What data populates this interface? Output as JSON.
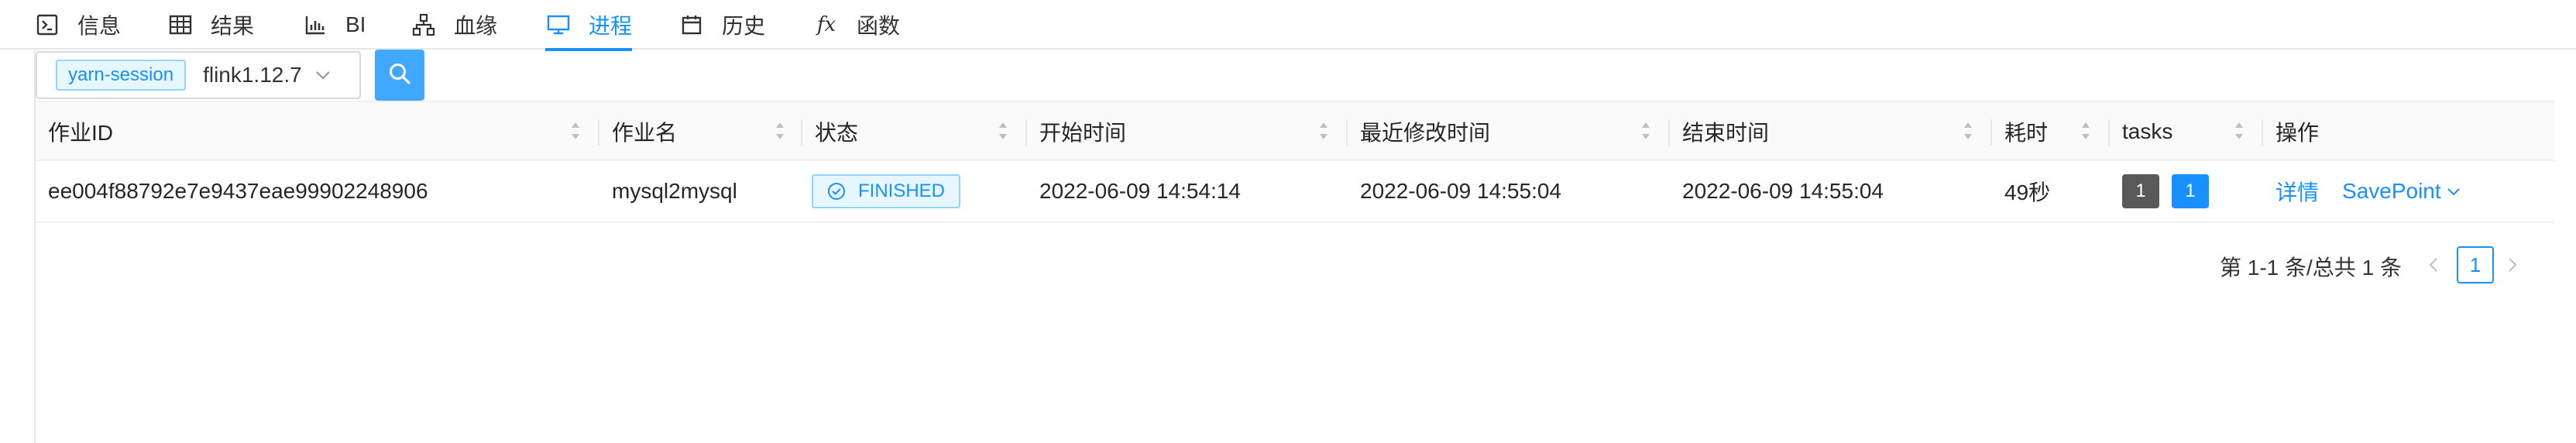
{
  "tabs": [
    {
      "label": "信息",
      "icon": "terminal-icon"
    },
    {
      "label": "结果",
      "icon": "table-icon"
    },
    {
      "label": "BI",
      "icon": "bar-chart-icon"
    },
    {
      "label": "血缘",
      "icon": "lineage-icon"
    },
    {
      "label": "进程",
      "icon": "desktop-icon",
      "active": true
    },
    {
      "label": "历史",
      "icon": "calendar-icon"
    },
    {
      "label": "函数",
      "icon": "function-icon",
      "icon_text": "fx"
    }
  ],
  "search": {
    "tag": "yarn-session",
    "selected_cluster": "flink1.12.7"
  },
  "table": {
    "columns": [
      "作业ID",
      "作业名",
      "状态",
      "开始时间",
      "最近修改时间",
      "结束时间",
      "耗时",
      "tasks",
      "操作"
    ],
    "rows": [
      {
        "job_id": "ee004f88792e7e9437eae99902248906",
        "job_name": "mysql2mysql",
        "status": "FINISHED",
        "start_time": "2022-06-09 14:54:14",
        "last_modified": "2022-06-09 14:55:04",
        "end_time": "2022-06-09 14:55:04",
        "duration": "49秒",
        "tasks": [
          "1",
          "1"
        ],
        "actions": {
          "detail": "详情",
          "savepoint": "SavePoint"
        }
      }
    ]
  },
  "pagination": {
    "total_text": "第 1-1 条/总共 1 条",
    "current_page": "1"
  },
  "colors": {
    "primary": "#1890ff",
    "primary_light": "#40a9ff",
    "task_gray": "#595959",
    "border": "#e8e8e8"
  }
}
